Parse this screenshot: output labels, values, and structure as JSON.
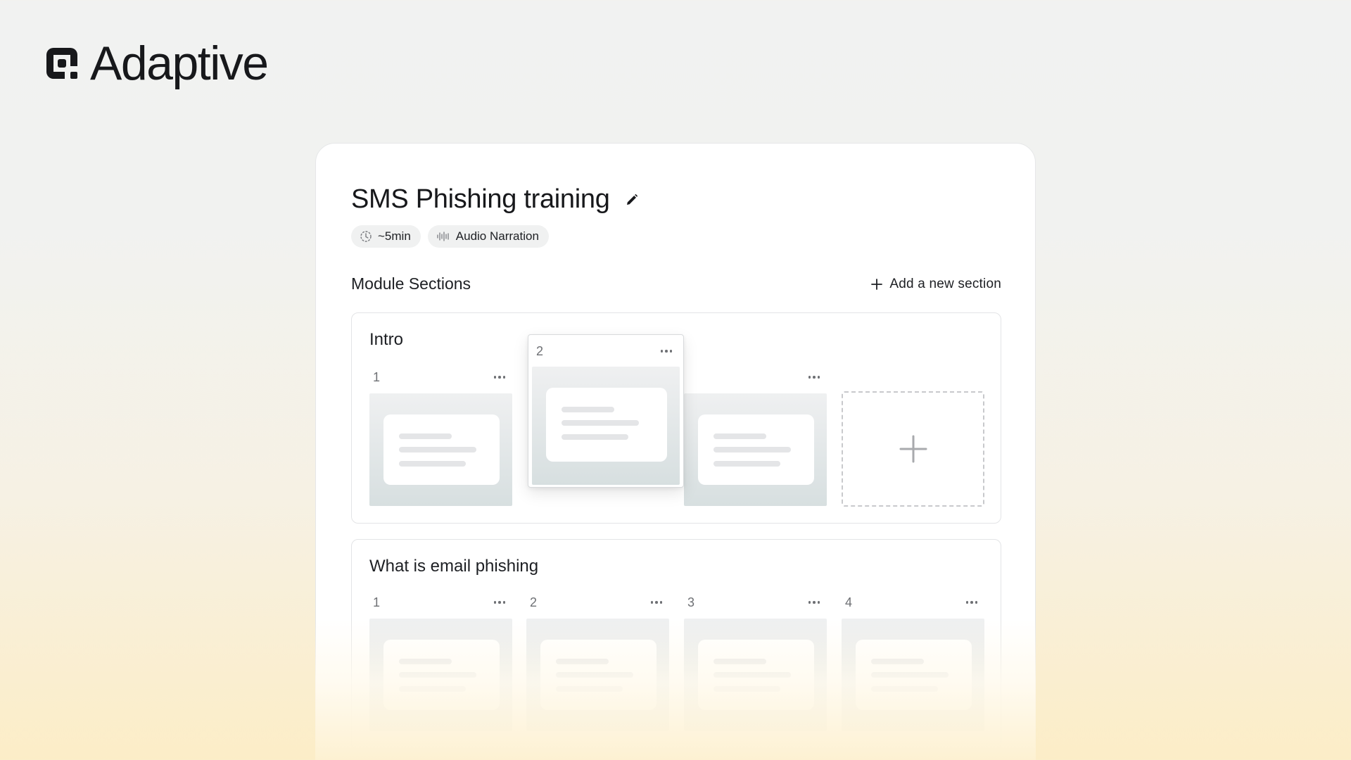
{
  "brand": {
    "name": "Adaptive",
    "icon": "adaptive-logo-icon"
  },
  "module": {
    "title": "SMS Phishing training",
    "edit_icon": "pencil-icon",
    "chips": [
      {
        "icon": "clock-icon",
        "label": "~5min"
      },
      {
        "icon": "waveform-icon",
        "label": "Audio Narration"
      }
    ]
  },
  "sections_header": {
    "title": "Module Sections",
    "add_label": "Add a new section",
    "add_icon": "plus-icon"
  },
  "sections": [
    {
      "name": "Intro",
      "slides": [
        {
          "number": "1"
        },
        {
          "number": ""
        }
      ],
      "dragging_slide": {
        "number": "2"
      },
      "add_slide_icon": "plus-icon"
    },
    {
      "name": "What is email phishing",
      "slides": [
        {
          "number": "1"
        },
        {
          "number": "2"
        },
        {
          "number": "3"
        },
        {
          "number": "4"
        }
      ]
    }
  ]
}
